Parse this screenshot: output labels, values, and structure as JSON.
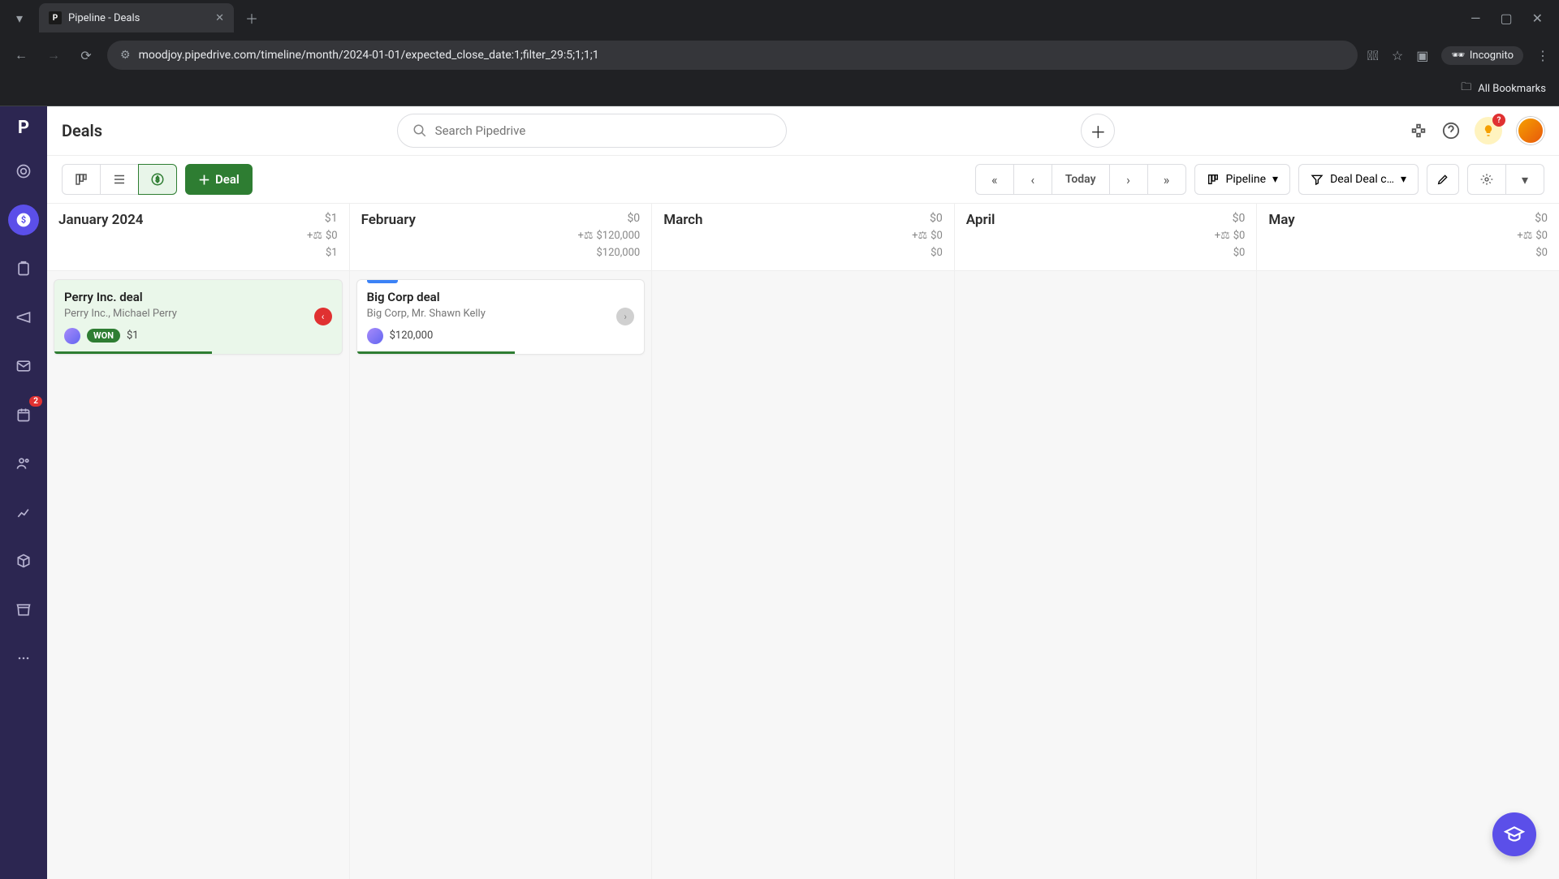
{
  "browser": {
    "tab_title": "Pipeline - Deals",
    "url": "moodjoy.pipedrive.com/timeline/month/2024-01-01/expected_close_date:1;filter_29:5;1;1;1",
    "incognito_label": "Incognito",
    "all_bookmarks": "All Bookmarks"
  },
  "sidebar": {
    "badge_count": "2"
  },
  "header": {
    "title": "Deals",
    "search_placeholder": "Search Pipedrive"
  },
  "toolbar": {
    "deal_button": "Deal",
    "today": "Today",
    "pipeline_dropdown": "Pipeline",
    "filter_dropdown": "Deal Deal c…"
  },
  "months": [
    {
      "name": "January 2024",
      "total": "$1",
      "weighted": "$0",
      "secondary": "$1"
    },
    {
      "name": "February",
      "total": "$0",
      "weighted": "$120,000",
      "secondary": "$120,000"
    },
    {
      "name": "March",
      "total": "$0",
      "weighted": "$0",
      "secondary": "$0"
    },
    {
      "name": "April",
      "total": "$0",
      "weighted": "$0",
      "secondary": "$0"
    },
    {
      "name": "May",
      "total": "$0",
      "weighted": "$0",
      "secondary": "$0"
    }
  ],
  "deals": {
    "january": {
      "title": "Perry Inc. deal",
      "subtitle": "Perry Inc., Michael Perry",
      "badge": "WON",
      "amount": "$1",
      "progress_pct": 55,
      "status": "overdue"
    },
    "february": {
      "title": "Big Corp deal",
      "subtitle": "Big Corp, Mr. Shawn Kelly",
      "amount": "$120,000",
      "progress_pct": 55,
      "status": "none"
    }
  }
}
